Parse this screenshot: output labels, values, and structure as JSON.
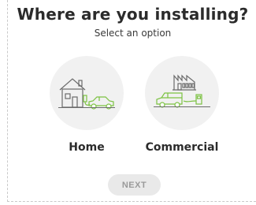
{
  "header": {
    "title": "Where are you installing?",
    "subtitle": "Select an option"
  },
  "options": [
    {
      "label": "Home",
      "icon": "house-car-charger-icon"
    },
    {
      "label": "Commercial",
      "icon": "factory-van-charger-icon"
    }
  ],
  "footer": {
    "next_label": "NEXT"
  },
  "colors": {
    "accent_green": "#7cc242",
    "icon_gray": "#6b6b6b",
    "circle_bg": "#f1f1f1",
    "button_bg": "#e9e9e9",
    "button_text_disabled": "#9a9a9a"
  }
}
